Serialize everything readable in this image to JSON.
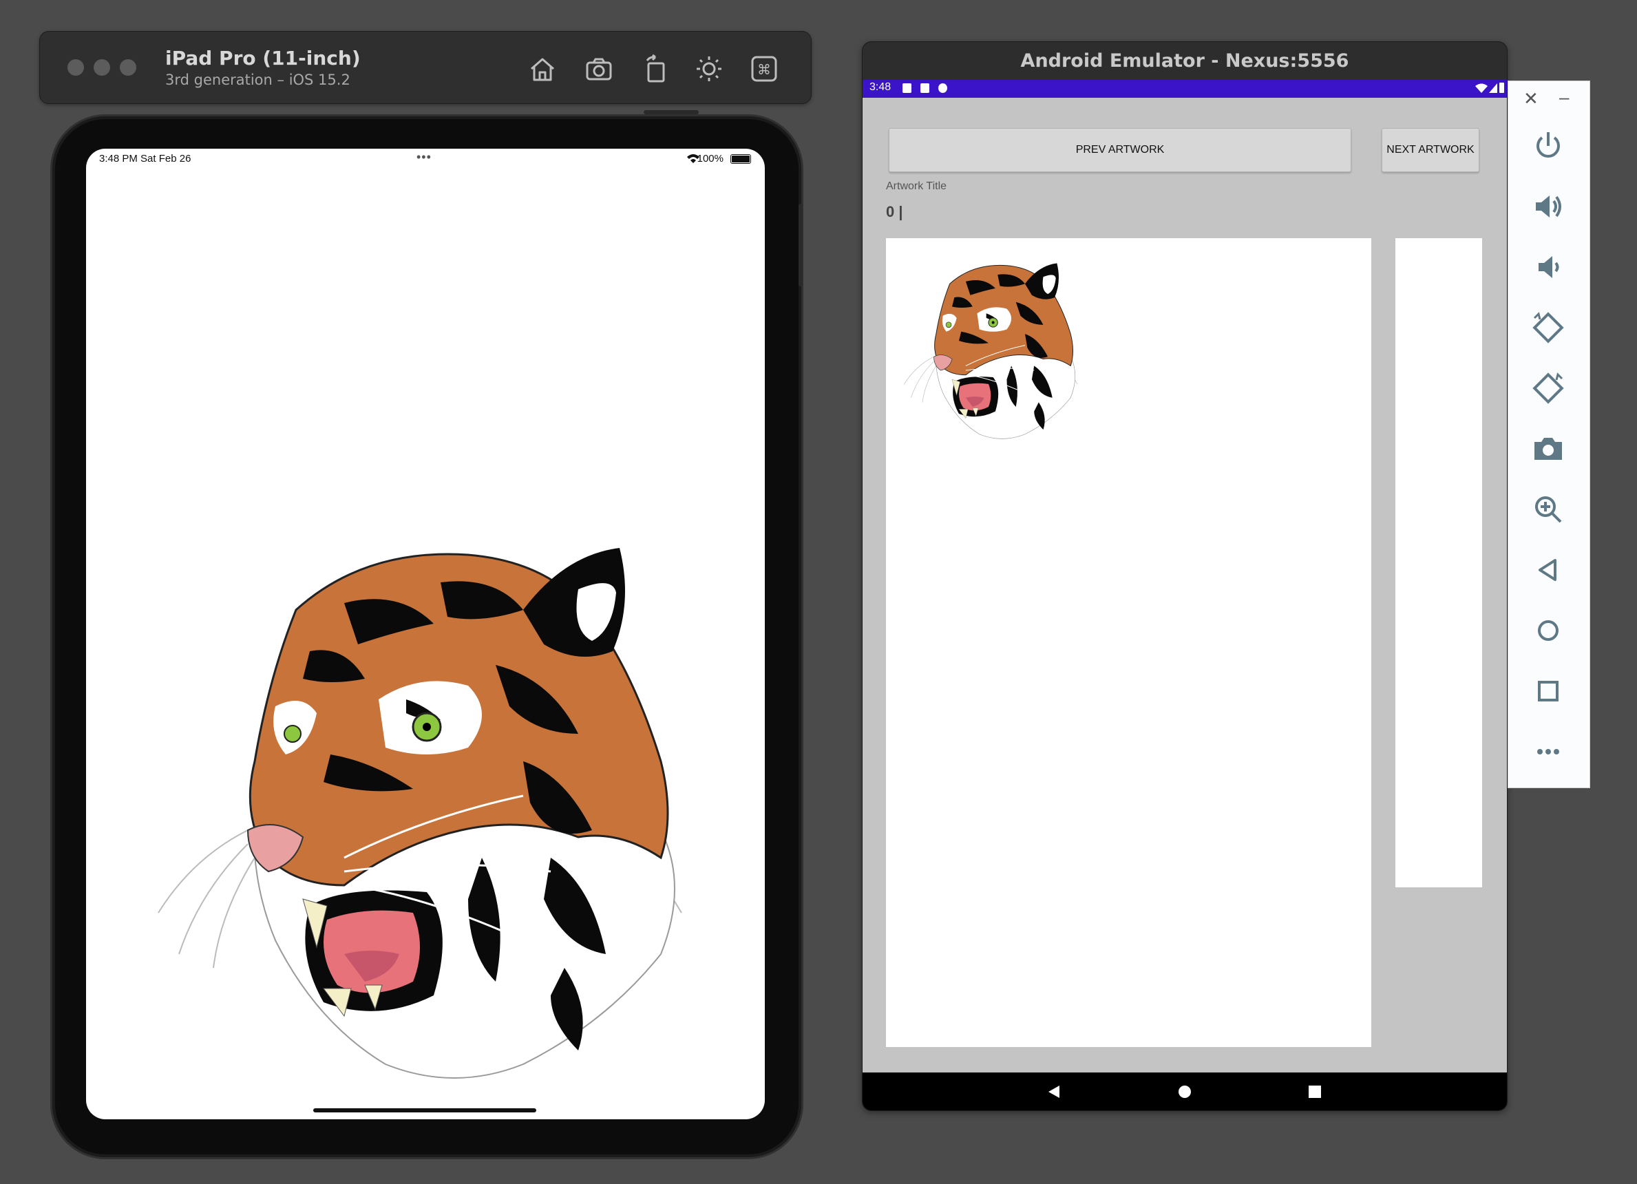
{
  "ios_simulator": {
    "device_name": "iPad Pro (11-inch)",
    "device_subtitle": "3rd generation – iOS 15.2",
    "toolbar_icons": [
      "home-icon",
      "screenshot-icon",
      "rotate-icon",
      "appearance-icon",
      "keyboard-command-icon"
    ],
    "status_bar": {
      "time_date": "3:48 PM   Sat Feb 26",
      "dots": "•••",
      "battery": "100%"
    }
  },
  "android_emulator": {
    "window_title": "Android Emulator - Nexus:5556",
    "status_bar": {
      "time": "3:48",
      "color": "#3b13c9"
    },
    "app": {
      "prev_button": "PREV ARTWORK",
      "next_button": "NEXT ARTWORK",
      "artwork_label": "Artwork Title",
      "artwork_value": "0 |"
    },
    "nav_icons": [
      "back-icon",
      "home-circle-icon",
      "recents-square-icon"
    ]
  },
  "side_panel": {
    "close": "✕",
    "minimize": "–",
    "icons": [
      "power-icon",
      "volume-up-icon",
      "volume-down-icon",
      "rotate-left-icon",
      "rotate-right-icon",
      "camera-icon",
      "zoom-icon",
      "back-triangle-icon",
      "home-circle-icon",
      "overview-square-icon",
      "more-icon"
    ]
  },
  "colors": {
    "tiger_orange": "#c8733a",
    "tiger_black": "#0a0a0a",
    "eye_green": "#8dc63f",
    "mouth_pink": "#e8727a"
  }
}
